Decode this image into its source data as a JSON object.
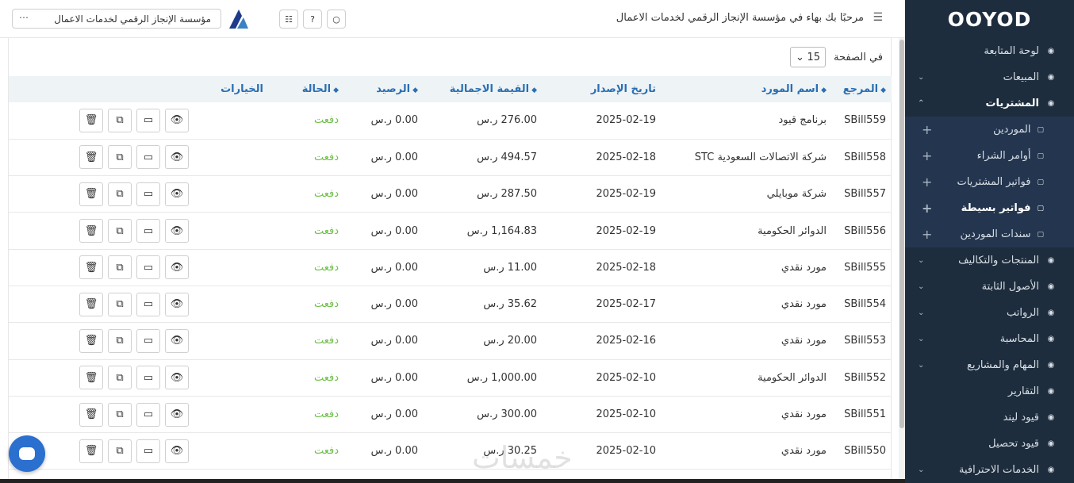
{
  "sidebar": {
    "logo": "OOYOD",
    "items": [
      {
        "label": "لوحة المتابعة",
        "icon": "dashboard-icon"
      },
      {
        "label": "المبيعات",
        "icon": "sales-icon"
      },
      {
        "label": "المشتريات",
        "icon": "purchases-icon"
      },
      {
        "label": "المنتجات والتكاليف",
        "icon": "products-icon"
      },
      {
        "label": "الأصول الثابتة",
        "icon": "assets-icon"
      },
      {
        "label": "الرواتب",
        "icon": "payroll-icon"
      },
      {
        "label": "المحاسبة",
        "icon": "accounting-icon"
      },
      {
        "label": "المهام والمشاريع",
        "icon": "tasks-icon"
      },
      {
        "label": "التقارير",
        "icon": "reports-icon"
      },
      {
        "label": "قيود ليند",
        "icon": "lend-icon"
      },
      {
        "label": "قيود تحصيل",
        "icon": "collection-icon"
      },
      {
        "label": "الخدمات الاحترافية",
        "icon": "services-icon"
      }
    ],
    "purchases_sub": [
      {
        "label": "الموردين"
      },
      {
        "label": "أوامر الشراء"
      },
      {
        "label": "فواتير المشتريات"
      },
      {
        "label": "فواتير بسيطة"
      },
      {
        "label": "سندات الموردين"
      }
    ]
  },
  "header": {
    "welcome": "مرحبًا بك بهاء في مؤسسة الإنجاز الرقمي لخدمات الاعمال",
    "company": "مؤسسة الإنجاز الرقمي لخدمات الاعمال"
  },
  "pagination": {
    "label": "في الصفحة",
    "value": "15"
  },
  "table": {
    "columns": [
      "المرجع",
      "اسم المورد",
      "تاريخ الإصدار",
      "القيمة الاجمالية",
      "الرصيد",
      "الحالة",
      "الخيارات"
    ],
    "rows": [
      {
        "ref": "SBill559",
        "supplier": "برنامج قيود",
        "date": "2025-02-19",
        "total": "276.00 ر.س",
        "balance": "0.00 ر.س",
        "status": "دفعت"
      },
      {
        "ref": "SBill558",
        "supplier": "شركة الاتصالات السعودية STC",
        "date": "2025-02-18",
        "total": "494.57 ر.س",
        "balance": "0.00 ر.س",
        "status": "دفعت"
      },
      {
        "ref": "SBill557",
        "supplier": "شركة موبايلي",
        "date": "2025-02-19",
        "total": "287.50 ر.س",
        "balance": "0.00 ر.س",
        "status": "دفعت"
      },
      {
        "ref": "SBill556",
        "supplier": "الدوائر الحكومية",
        "date": "2025-02-19",
        "total": "1,164.83 ر.س",
        "balance": "0.00 ر.س",
        "status": "دفعت"
      },
      {
        "ref": "SBill555",
        "supplier": "مورد نقدي",
        "date": "2025-02-18",
        "total": "11.00 ر.س",
        "balance": "0.00 ر.س",
        "status": "دفعت"
      },
      {
        "ref": "SBill554",
        "supplier": "مورد نقدي",
        "date": "2025-02-17",
        "total": "35.62 ر.س",
        "balance": "0.00 ر.س",
        "status": "دفعت"
      },
      {
        "ref": "SBill553",
        "supplier": "مورد نقدي",
        "date": "2025-02-16",
        "total": "20.00 ر.س",
        "balance": "0.00 ر.س",
        "status": "دفعت"
      },
      {
        "ref": "SBill552",
        "supplier": "الدوائر الحكومية",
        "date": "2025-02-10",
        "total": "1,000.00 ر.س",
        "balance": "0.00 ر.س",
        "status": "دفعت"
      },
      {
        "ref": "SBill551",
        "supplier": "مورد نقدي",
        "date": "2025-02-10",
        "total": "300.00 ر.س",
        "balance": "0.00 ر.س",
        "status": "دفعت"
      },
      {
        "ref": "SBill550",
        "supplier": "مورد نقدي",
        "date": "2025-02-10",
        "total": "30.25 ر.س",
        "balance": "0.00 ر.س",
        "status": "دفعت"
      }
    ]
  },
  "watermark": "خمسات",
  "colors": {
    "sidebar_bg": "#1e2d3d",
    "submenu_bg": "#24364f",
    "header_text": "#2a6fb3",
    "status_paid": "#6fbf4a",
    "chat_button": "#2b6fcf"
  }
}
